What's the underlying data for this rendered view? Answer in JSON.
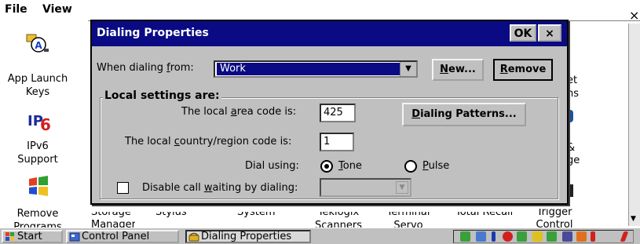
{
  "menubar": {
    "file": "File",
    "view": "View"
  },
  "control_panel": {
    "items": [
      {
        "label_line1": "App Launch",
        "label_line2": "Keys",
        "icon": "app-launch-keys-icon"
      },
      {
        "label_line1": "IPv6",
        "label_line2": "Support",
        "icon": "ipv6-icon"
      },
      {
        "label_line1": "Remove",
        "label_line2": "Programs",
        "icon": "remove-programs-icon"
      }
    ],
    "partial_labels": {
      "storage_manager": "Storage Manager",
      "stylus": "Stylus",
      "system": "System",
      "teklogix_scanners": "Teklogix Scanners",
      "terminal_servo": "Terminal Servo",
      "total_recall": "Total Recall",
      "trigger_control": "Trigger Control",
      "right_frag1": "et",
      "right_frag2": "ns",
      "right_frag3": "&",
      "right_frag4": "ge"
    }
  },
  "dialog": {
    "title": "Dialing Properties",
    "ok_label": "OK",
    "close_label": "×",
    "dialing_from_label": "When dialing from:",
    "dialing_from_value": "Work",
    "new_button": "New...",
    "remove_button": "Remove",
    "group_title": "Local settings are:",
    "area_code_label": "The local area code is:",
    "area_code_value": "425",
    "country_code_label": "The local country/region code is:",
    "country_code_value": "1",
    "dialing_patterns_button": "Dialing Patterns...",
    "dial_using_label": "Dial using:",
    "tone_label": "Tone",
    "pulse_label": "Pulse",
    "dial_using_selected": "Tone",
    "call_waiting_label": "Disable call waiting by dialing:",
    "call_waiting_checked": false,
    "call_waiting_value": ""
  },
  "taskbar": {
    "start": "Start",
    "control_panel": "Control Panel",
    "dialing_properties": "Dialing Properties"
  },
  "colors": {
    "titlebar": "#0a0a84",
    "dialog_bg": "#c0c0c0",
    "selection": "#0a0a84"
  }
}
